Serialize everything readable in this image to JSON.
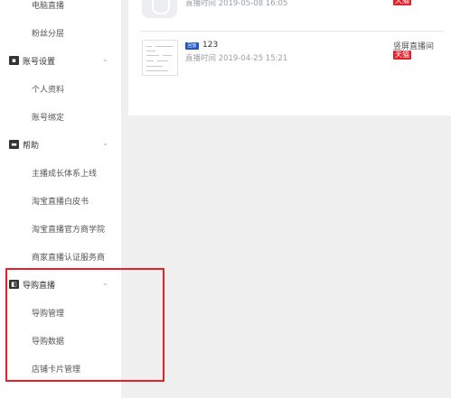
{
  "sidebar": {
    "items": [
      {
        "label": "电脑直播"
      },
      {
        "label": "粉丝分层"
      },
      {
        "label": "账号设置",
        "icon": "id-card-icon"
      },
      {
        "label": "个人资料"
      },
      {
        "label": "账号绑定"
      },
      {
        "label": "帮助",
        "icon": "book-icon"
      },
      {
        "label": "主播成长体系上线"
      },
      {
        "label": "淘宝直播白皮书"
      },
      {
        "label": "淘宝直播官方商学院"
      },
      {
        "label": "商家直播认证服务商"
      },
      {
        "label": "导购直播",
        "icon": "shopping-guide-icon"
      },
      {
        "label": "导购管理"
      },
      {
        "label": "导购数据"
      },
      {
        "label": "店铺卡片管理"
      }
    ]
  },
  "live_list": {
    "rows": [
      {
        "title": "",
        "time": "直播时间 2019-05-08 16:05",
        "tag": "天猫"
      },
      {
        "badge": "回放",
        "title": "123",
        "time": "直播时间 2019-04-25 15:21",
        "room_type": "竖屏直播间",
        "tag": "天猫"
      }
    ]
  },
  "colors": {
    "highlight": "#e8202a",
    "badge_blue": "#1e58c4",
    "tmall_red": "#e0242e"
  }
}
